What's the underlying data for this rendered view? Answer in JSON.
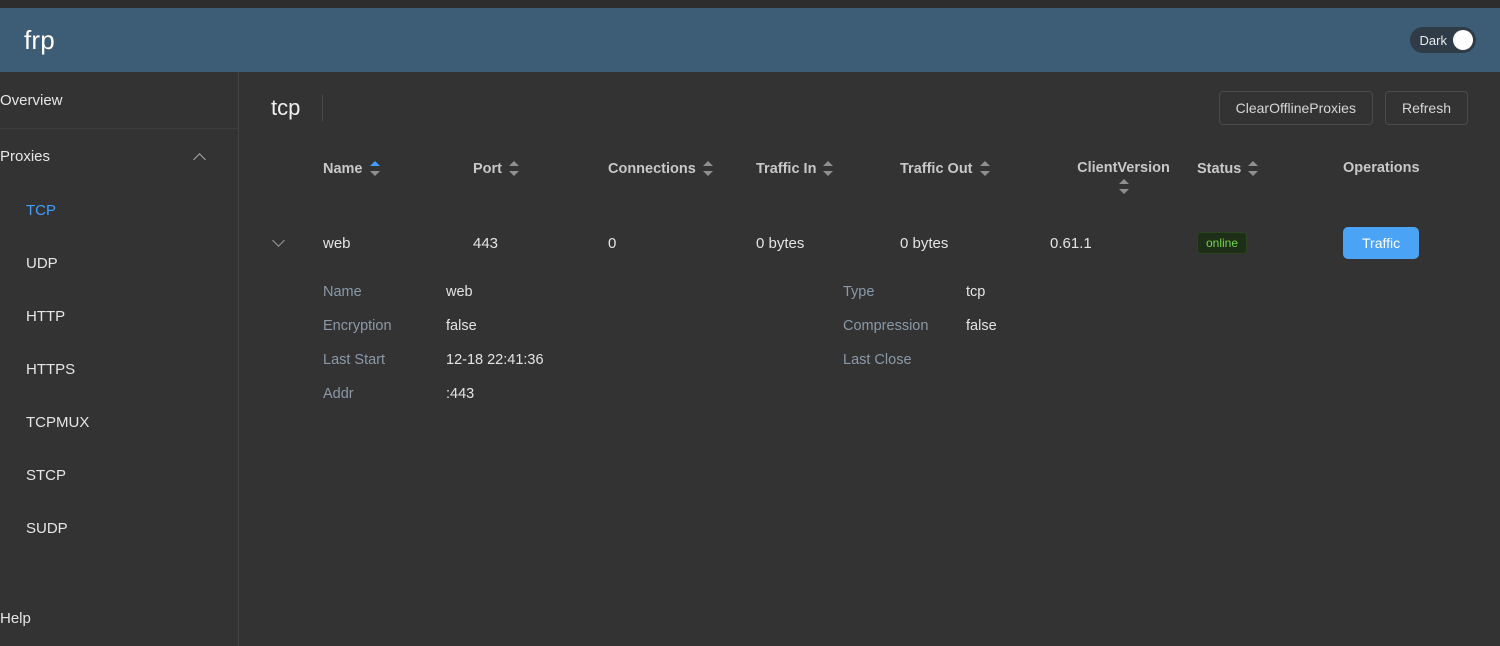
{
  "header": {
    "brand": "frp",
    "dark_toggle_label": "Dark",
    "accent_color": "#3c5d75"
  },
  "sidebar": {
    "overview_label": "Overview",
    "group": {
      "label": "Proxies",
      "chevron_icon": "chevron-up-icon",
      "items": [
        {
          "label": "TCP",
          "active": true
        },
        {
          "label": "UDP",
          "active": false
        },
        {
          "label": "HTTP",
          "active": false
        },
        {
          "label": "HTTPS",
          "active": false
        },
        {
          "label": "TCPMUX",
          "active": false
        },
        {
          "label": "STCP",
          "active": false
        },
        {
          "label": "SUDP",
          "active": false
        }
      ]
    },
    "help_label": "Help",
    "active_color": "#409eff"
  },
  "content": {
    "page_title": "tcp",
    "clear_offline_label": "ClearOfflineProxies",
    "refresh_label": "Refresh"
  },
  "table": {
    "columns": [
      {
        "label": "Name",
        "sortable": true,
        "sort": "asc"
      },
      {
        "label": "Port",
        "sortable": true,
        "sort": "none"
      },
      {
        "label": "Connections",
        "sortable": true,
        "sort": "none"
      },
      {
        "label": "Traffic In",
        "sortable": true,
        "sort": "none"
      },
      {
        "label": "Traffic Out",
        "sortable": true,
        "sort": "none"
      },
      {
        "label": "ClientVersion",
        "sortable": true,
        "sort": "none"
      },
      {
        "label": "Status",
        "sortable": true,
        "sort": "none"
      },
      {
        "label": "Operations",
        "sortable": false,
        "sort": "none"
      }
    ],
    "rows": [
      {
        "name": "web",
        "port": "443",
        "connections": "0",
        "traffic_in": "0 bytes",
        "traffic_out": "0 bytes",
        "client_version": "0.61.1",
        "status": "online",
        "operation_label": "Traffic",
        "expanded": true
      }
    ]
  },
  "detail": {
    "left": [
      {
        "label": "Name",
        "value": "web"
      },
      {
        "label": "Encryption",
        "value": "false"
      },
      {
        "label": "Last Start",
        "value": "12-18 22:41:36"
      },
      {
        "label": "Addr",
        "value": ":443"
      }
    ],
    "right": [
      {
        "label": "Type",
        "value": "tcp"
      },
      {
        "label": "Compression",
        "value": "false"
      },
      {
        "label": "Last Close",
        "value": ""
      }
    ]
  },
  "colors": {
    "status_online_text": "#74d64a",
    "status_online_bg": "#1d2f16",
    "primary_button": "#4aa3f5",
    "background": "#333333"
  }
}
